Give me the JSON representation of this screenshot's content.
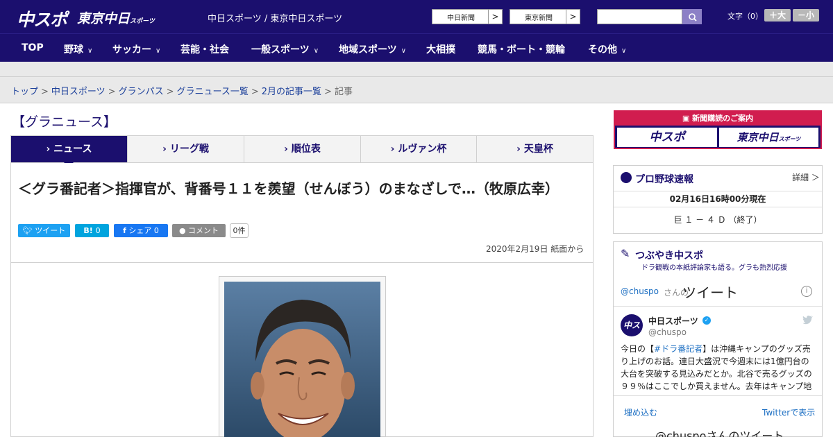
{
  "header": {
    "logo_chuspo": "中スポ",
    "logo_tokyo": "東京中日",
    "logo_tokyo_sub": "スポーツ",
    "site_names": "中日スポーツ / 東京中日スポーツ",
    "link_chunichi": "中日新聞",
    "link_tokyo": "東京新聞",
    "link_arrow": ">",
    "search_placeholder": "",
    "fontsize_label": "文字（0）",
    "fontsize_up": "＋大",
    "fontsize_down": "－小"
  },
  "nav": [
    {
      "label": "TOP",
      "chev": ""
    },
    {
      "label": "野球",
      "chev": "∨"
    },
    {
      "label": "サッカー",
      "chev": "∨"
    },
    {
      "label": "芸能・社会",
      "chev": ""
    },
    {
      "label": "一般スポーツ",
      "chev": "∨"
    },
    {
      "label": "地域スポーツ",
      "chev": "∨"
    },
    {
      "label": "大相撲",
      "chev": ""
    },
    {
      "label": "競馬・ボート・競輪",
      "chev": ""
    },
    {
      "label": "その他",
      "chev": "∨"
    }
  ],
  "breadcrumb": {
    "items": [
      "トップ",
      "中日スポーツ",
      "グランパス",
      "グラニュース一覧",
      "2月の記事一覧"
    ],
    "current": "記事",
    "sep": ">"
  },
  "section_title": "【グラニュース】",
  "tabs": [
    {
      "label": "› ニュース"
    },
    {
      "label": "› リーグ戦"
    },
    {
      "label": "› 順位表"
    },
    {
      "label": "› ルヴァン杯"
    },
    {
      "label": "› 天皇杯"
    }
  ],
  "article": {
    "headline": "＜グラ番記者＞指揮官が、背番号１１を羨望（せんぼう）のまなざしで…（牧原広幸）",
    "dateline": "2020年2月19日 紙面から"
  },
  "share": {
    "tweet": "ツイート",
    "hatena_label": "B!",
    "hatena_count": "0",
    "facebook": "シェア 0",
    "comment": "コメント",
    "comment_count": "0件"
  },
  "sidebar": {
    "subscription_head": "新聞購読のご案内",
    "sub_logo_1": "中スポ",
    "sub_logo_2": "東京中日",
    "sub_logo_2_sub": "スポーツ",
    "baseball": {
      "title": "プロ野球速報",
      "detail": "詳細 ＞",
      "time": "02月16日16時00分現在",
      "score": "巨 １ － ４ Ｄ （終了）"
    },
    "tweets": {
      "title": "つぶやき中スポ",
      "subtitle": "ドラ観戦の本紙評論家も語る。グラも熱烈応援",
      "handle": "@chuspo",
      "handle_suffix": "さんの",
      "heading": "ツイート",
      "info": "i",
      "account_name": "中日スポーツ",
      "account_handle": "@chuspo",
      "avatar": "中スポ",
      "text_a": "今日の【",
      "text_hashtag": "#ドラ番記者",
      "text_b": "】は沖縄キャンプのグッズ売り上げのお話。連日大盛況で今週末には1億円台の大台を突破する見込みだとか。北谷で売るグッズの９９％はここでしか買えません。去年はキャンプ地",
      "embed": "埋め込む",
      "view_on_twitter": "Twitterで表示",
      "next_heading": "@chuspoさんのツイート"
    }
  },
  "colors": {
    "brand": "#1b0f6e",
    "accent_red": "#d11d4f",
    "twitter": "#1da1f2",
    "hatena": "#00a4de",
    "facebook": "#1877f2",
    "comment": "#8a8a8a",
    "link": "#1b3f9a"
  }
}
